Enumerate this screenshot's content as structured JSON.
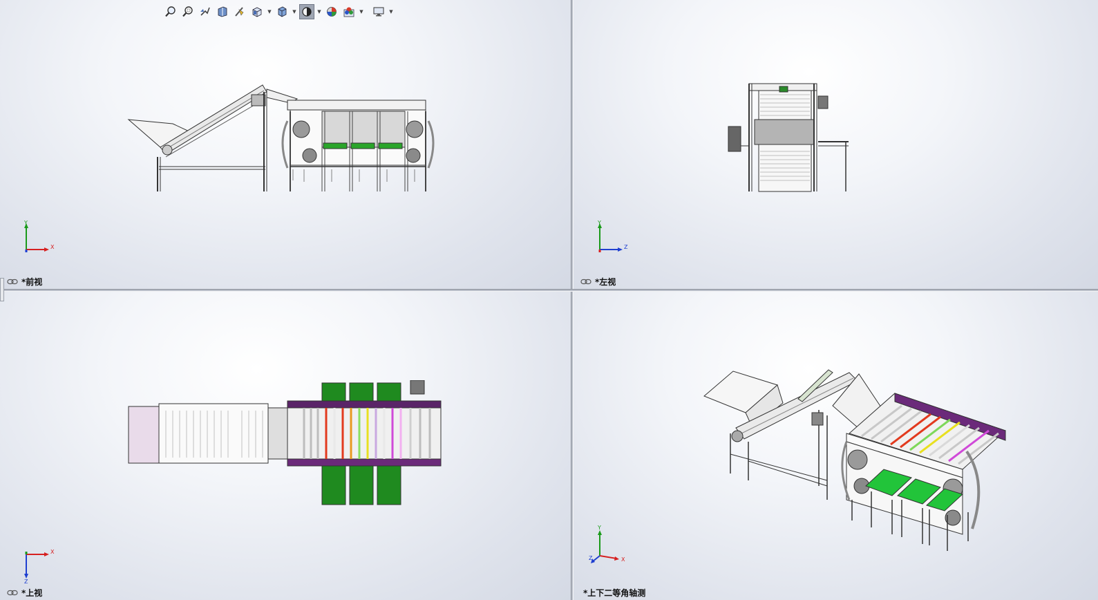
{
  "toolbar": {
    "buttons": [
      {
        "name": "zoom-to-fit-icon"
      },
      {
        "name": "zoom-to-area-icon"
      },
      {
        "name": "previous-view-icon"
      },
      {
        "name": "section-view-icon"
      },
      {
        "name": "dynamic-annotation-icon"
      },
      {
        "name": "view-orientation-icon",
        "dropdown": true
      },
      {
        "name": "display-style-icon",
        "dropdown": true
      },
      {
        "name": "hide-show-items-icon",
        "dropdown": true,
        "active": true
      },
      {
        "name": "edit-appearance-icon",
        "dropdown": true
      },
      {
        "name": "view-settings-icon",
        "dropdown": true
      }
    ]
  },
  "viewports": {
    "front": {
      "label": "*前视",
      "axis_h": "X",
      "axis_v": "Y"
    },
    "left": {
      "label": "*左视",
      "axis_h": "Z",
      "axis_v": "Y"
    },
    "top": {
      "label": "*上视",
      "axis_h": "X",
      "axis_v": "Z"
    },
    "iso": {
      "label": "*上下二等角轴测",
      "axis_h": "X",
      "axis_v": "Y",
      "axis_d": "Z"
    }
  },
  "colors": {
    "axis_x": "#d62020",
    "axis_y": "#1a9a1a",
    "axis_z": "#1f3fd0",
    "belt_green": "#1f8a1f",
    "rail_purple": "#6b2a7a",
    "roller_red": "#e23a1e",
    "roller_yellow": "#e8e020",
    "roller_magenta": "#d04ad8",
    "hopper_pink": "#e9dbea"
  }
}
